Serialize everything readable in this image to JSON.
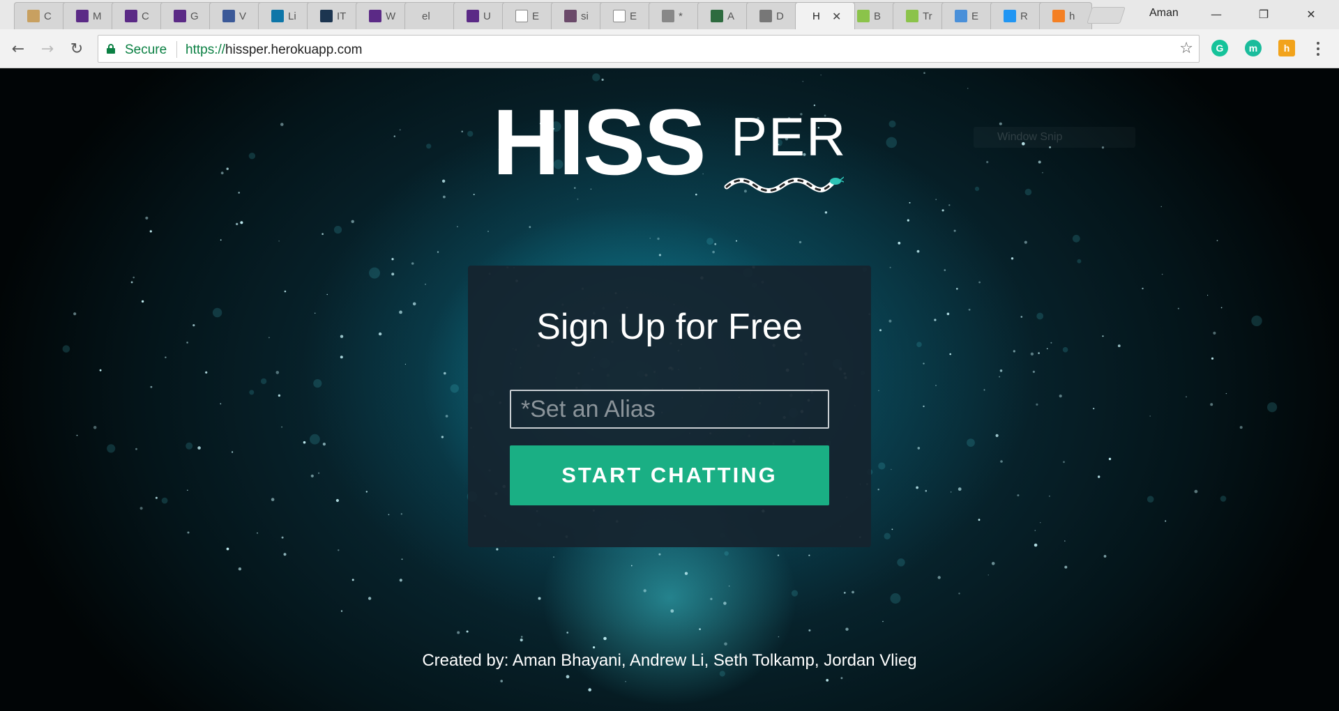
{
  "browser": {
    "tabs": [
      {
        "title": "C",
        "icon": "generic-icon",
        "color": "#c8a060"
      },
      {
        "title": "M",
        "icon": "shield-icon",
        "color": "#5b2a86"
      },
      {
        "title": "C",
        "icon": "shield-icon",
        "color": "#5b2a86"
      },
      {
        "title": "G",
        "icon": "shield-icon",
        "color": "#5b2a86"
      },
      {
        "title": "V",
        "icon": "facebook-icon",
        "color": "#3b5998"
      },
      {
        "title": "Li",
        "icon": "linkedin-icon",
        "color": "#0e76a8"
      },
      {
        "title": "IT",
        "icon": "tr-icon",
        "color": "#1c3550"
      },
      {
        "title": "W",
        "icon": "shield-icon",
        "color": "#5b2a86"
      },
      {
        "title": "el",
        "icon": "none",
        "color": "#d6d6d6"
      },
      {
        "title": "U",
        "icon": "shield-icon",
        "color": "#5b2a86"
      },
      {
        "title": "E",
        "icon": "document-icon",
        "color": "#ffffff"
      },
      {
        "title": "si",
        "icon": "hash-icon",
        "color": "#6b4a6a"
      },
      {
        "title": "E",
        "icon": "document-icon",
        "color": "#ffffff"
      },
      {
        "title": "*",
        "icon": "notes-icon",
        "color": "#888888"
      },
      {
        "title": "A",
        "icon": "ab-icon",
        "color": "#2e6b3f"
      },
      {
        "title": "D",
        "icon": "code-icon",
        "color": "#777777"
      },
      {
        "title": "H",
        "icon": "none",
        "color": "#f2f2f2"
      },
      {
        "title": "B",
        "icon": "w3-icon",
        "color": "#8bc34a"
      },
      {
        "title": "Tr",
        "icon": "w3-icon",
        "color": "#8bc34a"
      },
      {
        "title": "E",
        "icon": "cloud-icon",
        "color": "#4a90d9"
      },
      {
        "title": "R",
        "icon": "ten-icon",
        "color": "#2196f3"
      },
      {
        "title": "h",
        "icon": "stack-icon",
        "color": "#f48024"
      }
    ],
    "active_tab_close": "✕",
    "profile": "Aman",
    "window_controls": {
      "minimize": "—",
      "restore": "❐",
      "close": "✕"
    },
    "nav": {
      "back": "←",
      "forward": "→",
      "reload": "↻"
    },
    "secure_label": "Secure",
    "url_scheme": "https://",
    "url_host": "hissper.herokuapp.com",
    "bookmark_star": "☆",
    "extensions": [
      {
        "name": "grammarly-icon",
        "label": "G",
        "color": "#15c39a"
      },
      {
        "name": "mercury-icon",
        "label": "m",
        "color": "#1abc9c"
      },
      {
        "name": "honey-icon",
        "label": "h",
        "color": "#f2a31b"
      }
    ]
  },
  "page": {
    "logo_bold": "HISS",
    "logo_light": "PER",
    "ghost_text": "Window Snip",
    "signup": {
      "title": "Sign Up for Free",
      "alias_placeholder": "*Set an Alias",
      "alias_value": "",
      "button_label": "START CHATTING"
    },
    "credits": "Created by: Aman Bhayani, Andrew Li, Seth Tolkamp, Jordan Vlieg"
  }
}
